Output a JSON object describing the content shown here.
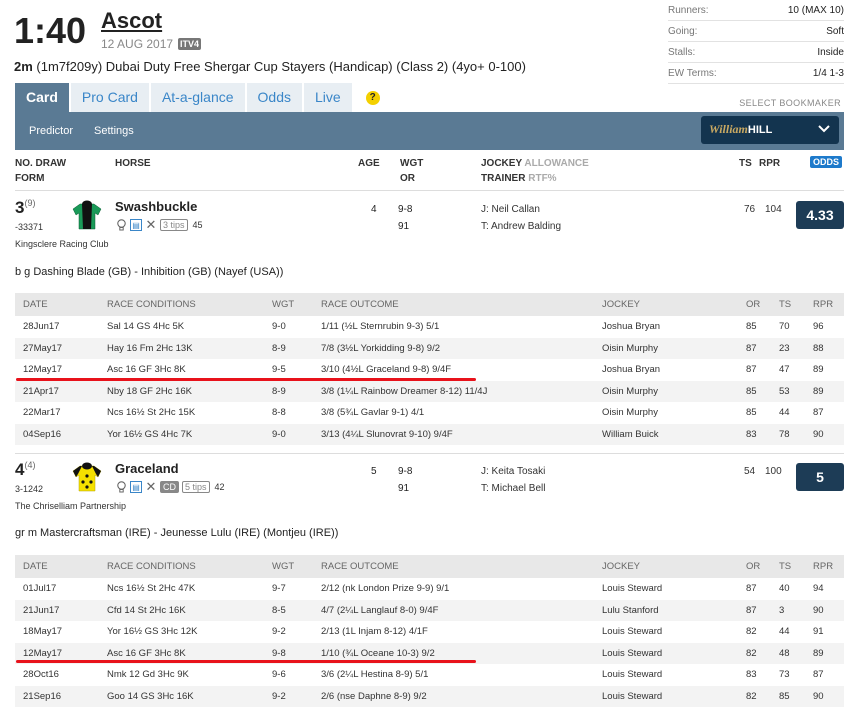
{
  "race": {
    "time": "1:40",
    "course": "Ascot",
    "date": "12 AUG 2017",
    "tv": "ITV4",
    "distance": "2m",
    "distance_detail": "(1m7f209y) Dubai Duty Free Shergar Cup Stayers (Handicap) (Class 2) (4yo+ 0-100)"
  },
  "info": [
    {
      "k": "Runners:",
      "v": "10 (MAX 10)"
    },
    {
      "k": "Going:",
      "v": "Soft"
    },
    {
      "k": "Stalls:",
      "v": "Inside"
    },
    {
      "k": "EW Terms:",
      "v": "1/4 1-3"
    }
  ],
  "tabs": [
    "Card",
    "Pro Card",
    "At-a-glance",
    "Odds",
    "Live"
  ],
  "help_label": "?",
  "select_bookmaker": "SELECT BOOKMAKER",
  "subnav": {
    "predictor": "Predictor",
    "settings": "Settings"
  },
  "bookmaker": {
    "name": "William",
    "name2": "HILL"
  },
  "columns": {
    "no_draw": "NO.  DRAW",
    "form": "FORM",
    "horse": "HORSE",
    "age": "AGE",
    "wgt": "WGT",
    "or": "OR",
    "jockey": "JOCKEY",
    "allowance": "ALLOWANCE",
    "trainer": "TRAINER",
    "rtf": "RTF%",
    "ts": "TS",
    "rpr": "RPR",
    "odds": "ODDS"
  },
  "form_headers": [
    "DATE",
    "RACE CONDITIONS",
    "WGT",
    "RACE OUTCOME",
    "JOCKEY",
    "OR",
    "TS",
    "RPR"
  ],
  "runners": [
    {
      "num": "3",
      "draw": "(9)",
      "form": "-33371",
      "owner": "Kingsclere Racing Club",
      "name": "Swashbuckle",
      "tips": "3 tips",
      "rpr_small": "45",
      "cd": "",
      "age": "4",
      "wgt": "9-8",
      "or": "91",
      "jockey": "J: Neil Callan",
      "trainer": "T: Andrew Balding",
      "ts": "76",
      "rpr": "104",
      "odds": "4.33",
      "pedigree": "b g Dashing Blade (GB) - Inhibition (GB) (Nayef (USA))",
      "silk_body": "#1a9a58",
      "silk_accent": "#111111",
      "form_rows": [
        [
          "28Jun17",
          "Sal 14 GS 4Hc 5K",
          "9-0",
          "1/11 (½L Sternrubin 9-3) 5/1",
          "Joshua Bryan",
          "85",
          "70",
          "96"
        ],
        [
          "27May17",
          "Hay 16 Fm 2Hc 13K",
          "8-9",
          "7/8 (3½L Yorkidding 9-8) 9/2",
          "Oisin Murphy",
          "87",
          "23",
          "88"
        ],
        [
          "12May17",
          "Asc 16 GF 3Hc 8K",
          "9-5",
          "3/10 (4½L Graceland 9-8) 9/4F",
          "Joshua Bryan",
          "87",
          "47",
          "89"
        ],
        [
          "21Apr17",
          "Nby 18 GF 2Hc 16K",
          "8-9",
          "3/8 (1¼L Rainbow Dreamer 8-12) 11/4J",
          "Oisin Murphy",
          "85",
          "53",
          "89"
        ],
        [
          "22Mar17",
          "Ncs 16½ St 2Hc 15K",
          "8-8",
          "3/8 (5¾L Gavlar 9-1) 4/1",
          "Oisin Murphy",
          "85",
          "44",
          "87"
        ],
        [
          "04Sep16",
          "Yor 16½ GS 4Hc 7K",
          "9-0",
          "3/13 (4¼L Slunovrat 9-10) 9/4F",
          "William Buick",
          "83",
          "78",
          "90"
        ]
      ]
    },
    {
      "num": "4",
      "draw": "(4)",
      "form": "3-1242",
      "owner": "The Chriselliam Partnership",
      "name": "Graceland",
      "tips": "5 tips",
      "rpr_small": "42",
      "cd": "CD",
      "age": "5",
      "wgt": "9-8",
      "or": "91",
      "jockey": "J: Keita Tosaki",
      "trainer": "T: Michael Bell",
      "ts": "54",
      "rpr": "100",
      "odds": "5",
      "pedigree": "gr m Mastercraftsman (IRE) - Jeunesse Lulu (IRE) (Montjeu (IRE))",
      "silk_body": "#f5e000",
      "silk_accent": "#111111",
      "form_rows": [
        [
          "01Jul17",
          "Ncs 16½ St 2Hc 47K",
          "9-7",
          "2/12 (nk London Prize 9-9) 9/1",
          "Louis Steward",
          "87",
          "40",
          "94"
        ],
        [
          "21Jun17",
          "Cfd 14 St 2Hc 16K",
          "8-5",
          "4/7 (2¼L Langlauf 8-0) 9/4F",
          "Lulu Stanford",
          "87",
          "3",
          "90"
        ],
        [
          "18May17",
          "Yor 16½ GS 3Hc 12K",
          "9-2",
          "2/13 (1L Injam 8-12) 4/1F",
          "Louis Steward",
          "82",
          "44",
          "91"
        ],
        [
          "12May17",
          "Asc 16 GF 3Hc 8K",
          "9-8",
          "1/10 (¾L Oceane 10-3) 9/2",
          "Louis Steward",
          "82",
          "48",
          "89"
        ],
        [
          "28Oct16",
          "Nmk 12 Gd 3Hc 9K",
          "9-6",
          "3/6 (2¼L Hestina 8-9) 5/1",
          "Louis Steward",
          "83",
          "73",
          "87"
        ],
        [
          "21Sep16",
          "Goo 14 GS 3Hc 16K",
          "9-2",
          "2/6 (nse Daphne 8-9) 9/2",
          "Louis Steward",
          "82",
          "85",
          "90"
        ]
      ]
    }
  ],
  "annotation_color": "#e8121b"
}
